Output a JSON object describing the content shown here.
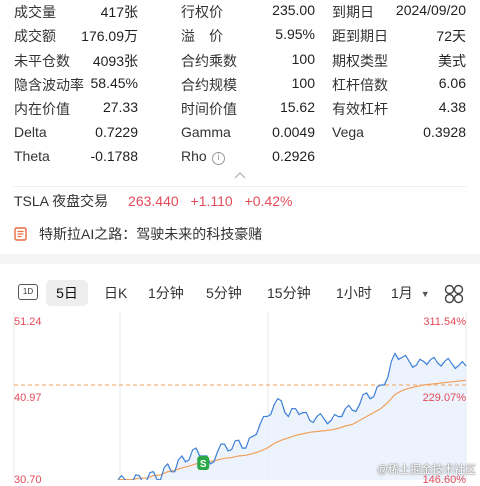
{
  "stats": {
    "rows": [
      [
        {
          "label": "成交量",
          "value": "417张"
        },
        {
          "label": "行权价",
          "value": "235.00"
        },
        {
          "label": "到期日",
          "value": "2024/09/20"
        }
      ],
      [
        {
          "label": "成交额",
          "value": "176.09万"
        },
        {
          "label": "溢　价",
          "value": "5.95%"
        },
        {
          "label": "距到期日",
          "value": "72天"
        }
      ],
      [
        {
          "label": "未平仓数",
          "value": "4093张"
        },
        {
          "label": "合约乘数",
          "value": "100"
        },
        {
          "label": "期权类型",
          "value": "美式"
        }
      ],
      [
        {
          "label": "隐含波动率",
          "value": "58.45%"
        },
        {
          "label": "合约规模",
          "value": "100"
        },
        {
          "label": "杠杆倍数",
          "value": "6.06"
        }
      ],
      [
        {
          "label": "内在价值",
          "value": "27.33"
        },
        {
          "label": "时间价值",
          "value": "15.62"
        },
        {
          "label": "有效杠杆",
          "value": "4.38"
        }
      ],
      [
        {
          "label": "Delta",
          "value": "0.7229"
        },
        {
          "label": "Gamma",
          "value": "0.0049"
        },
        {
          "label": "Vega",
          "value": "0.3928"
        }
      ],
      [
        {
          "label": "Theta",
          "value": "-0.1788"
        },
        {
          "label": "Rho",
          "value": "0.2926"
        }
      ]
    ]
  },
  "quote": {
    "name": "TSLA 夜盘交易",
    "price": "263.440",
    "change": "+1.110",
    "change_pct": "+0.42%"
  },
  "news": {
    "text": "特斯拉AI之路：驾驶未来的科技豪赌"
  },
  "tabs": {
    "items": [
      "1D",
      "5日",
      "日K",
      "1分钟",
      "5分钟",
      "15分钟",
      "1小时",
      "1月"
    ],
    "active": "5日"
  },
  "colors": {
    "up": "#e34b5a",
    "line": "#3d7fd6",
    "avg": "#f0a05a",
    "marker": "#2aa84a"
  },
  "chart_data": {
    "type": "line",
    "left_labels": [
      "51.24",
      "40.97",
      "30.70"
    ],
    "right_labels": [
      "311.54%",
      "229.07%",
      "146.60%"
    ],
    "marker": "S",
    "series": [
      {
        "values": [
          31,
          31,
          30.7,
          31.5,
          30.8,
          32,
          31,
          33,
          32,
          34,
          33.5,
          35,
          34,
          33,
          34.5,
          35.5,
          34.8,
          36,
          35,
          36.5,
          38,
          39,
          40.5,
          41,
          39,
          40,
          39.5,
          38.5,
          39,
          38.7,
          38.5,
          39,
          40,
          39.8,
          40.5,
          42,
          41.5,
          43,
          44,
          47,
          46.5,
          46,
          45.5,
          46,
          46.2,
          45.8,
          46,
          45.7,
          45.5,
          45.4
        ]
      },
      {
        "values": [
          31,
          31,
          31,
          31.2,
          31.2,
          31.5,
          31.6,
          32,
          32.2,
          32.5,
          32.7,
          33,
          33.1,
          33.3,
          33.5,
          33.7,
          33.8,
          34,
          34.1,
          34.3,
          34.6,
          35,
          35.6,
          36,
          36.3,
          36.6,
          36.8,
          37,
          37.1,
          37.2,
          37.3,
          37.5,
          37.8,
          38,
          38.5,
          39,
          39.5,
          40,
          40.8,
          41.8,
          42.3,
          42.6,
          42.8,
          43,
          43.1,
          43.2,
          43.3,
          43.4,
          43.5,
          43.6
        ]
      }
    ],
    "ylim": [
      30.7,
      51.24
    ],
    "reference": 43.0
  },
  "watermark": "@稀土掘金技术社区"
}
